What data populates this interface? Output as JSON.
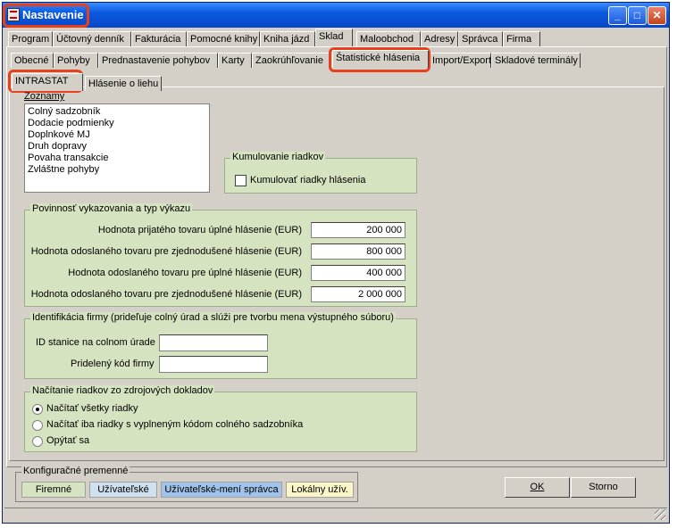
{
  "window": {
    "title": "Nastavenie"
  },
  "tabs_row1": [
    "Program",
    "Účtovný denník",
    "Fakturácia",
    "Pomocné knihy",
    "Kniha jázd",
    "Sklad",
    "Maloobchod",
    "Adresy",
    "Správca",
    "Firma"
  ],
  "tabs_row2": [
    "Obecné",
    "Pohyby",
    "Prednastavenie pohybov",
    "Karty",
    "Zaokrúhľovanie",
    "Štatistické hlásenia",
    "Import/Export",
    "Skladové terminály"
  ],
  "tabs_row3": [
    "INTRASTAT",
    "Hlásenie o liehu"
  ],
  "lists": {
    "label": "Zoznamy",
    "items": [
      "Colný sadzobník",
      "Dodacie podmienky",
      "Doplnkové MJ",
      "Druh dopravy",
      "Povaha transakcie",
      "Zvláštne pohyby"
    ]
  },
  "cumulation": {
    "label": "Kumulovanie riadkov",
    "checkbox": "Kumulovať riadky hlásenia"
  },
  "obligation": {
    "label": "Povinnosť vykazovania a typ výkazu",
    "rows": [
      {
        "label": "Hodnota prijatého tovaru úplné hlásenie (EUR)",
        "value": "200 000"
      },
      {
        "label": "Hodnota odoslaného tovaru pre zjednodušené hlásenie (EUR)",
        "value": "800 000"
      },
      {
        "label": "Hodnota odoslaného tovaru pre úplné hlásenie (EUR)",
        "value": "400 000"
      },
      {
        "label": "Hodnota odoslaného tovaru pre zjednodušené hlásenie (EUR)",
        "value": "2 000 000"
      }
    ]
  },
  "identification": {
    "label": "Identifikácia firmy (prideľuje colný úrad a slúži pre tvorbu mena výstupného súboru)",
    "station_label": "ID stanice na colnom úrade",
    "station_value": "",
    "code_label": "Pridelený kód firmy",
    "code_value": ""
  },
  "loading": {
    "label": "Načítanie riadkov zo zdrojových dokladov",
    "options": [
      "Načítať všetky riadky",
      "Načítať iba riadky s vyplneným kódom colného sadzobníka",
      "Opýtať sa"
    ]
  },
  "config": {
    "label": "Konfiguračné premenné",
    "chips": [
      "Firemné",
      "Užívateľské",
      "Užívateľské-mení správca",
      "Lokálny užív."
    ]
  },
  "buttons": {
    "ok": "OK",
    "cancel": "Storno"
  },
  "colors": {
    "group_bg": "#d6e3c0",
    "highlight": "#e8401c",
    "chip_firm": "#d6e3c0",
    "chip_user": "#cfe0ef",
    "chip_admin": "#9fc3ea",
    "chip_local": "#fbf6c8"
  }
}
